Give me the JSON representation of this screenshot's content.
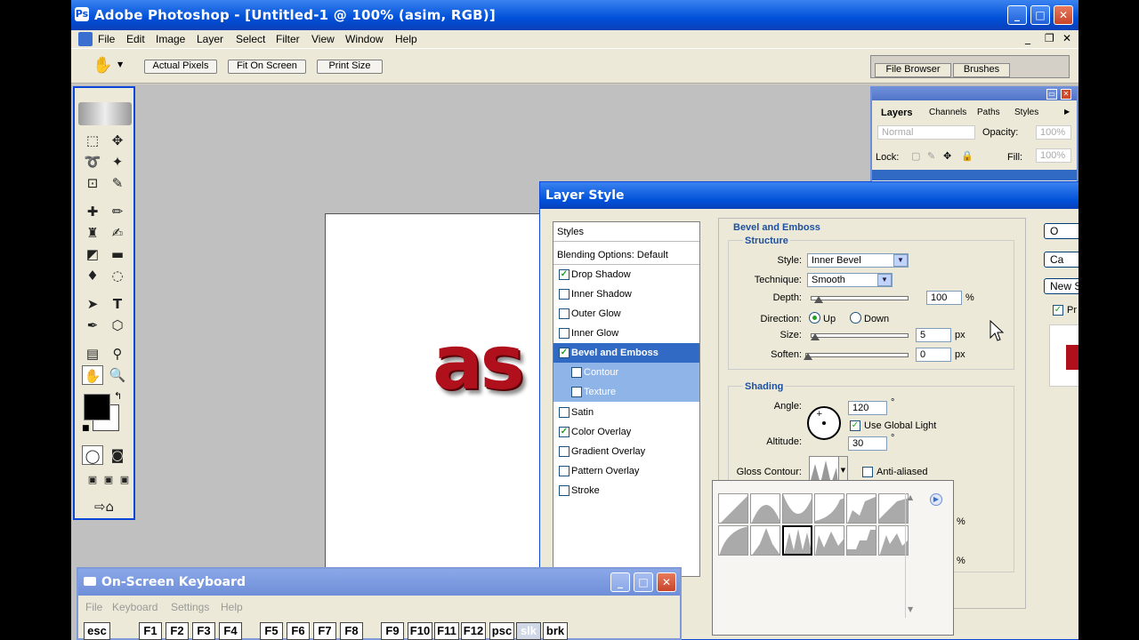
{
  "window": {
    "title": "Adobe Photoshop - [Untitled-1 @ 100% (asim, RGB)]",
    "min": "_",
    "max": "□",
    "close": "✕"
  },
  "menu": [
    "File",
    "Edit",
    "Image",
    "Layer",
    "Select",
    "Filter",
    "View",
    "Window",
    "Help"
  ],
  "options": {
    "actual_pixels": "Actual Pixels",
    "fit_on_screen": "Fit On Screen",
    "print_size": "Print Size",
    "file_browser": "File Browser",
    "brushes": "Brushes"
  },
  "document": {
    "text": "as"
  },
  "layers_palette": {
    "tabs": [
      "Layers",
      "Channels",
      "Paths",
      "Styles"
    ],
    "blend_mode": "Normal",
    "opacity_label": "Opacity:",
    "opacity_value": "100%",
    "lock_label": "Lock:",
    "fill_label": "Fill:",
    "fill_value": "100%"
  },
  "layer_style": {
    "title": "Layer Style",
    "list": [
      {
        "label": "Styles",
        "checkbox": false
      },
      {
        "label": "Blending Options: Default",
        "checkbox": false
      },
      {
        "label": "Drop Shadow",
        "checked": true
      },
      {
        "label": "Inner Shadow",
        "checked": false
      },
      {
        "label": "Outer Glow",
        "checked": false
      },
      {
        "label": "Inner Glow",
        "checked": false
      },
      {
        "label": "Bevel and Emboss",
        "checked": true
      },
      {
        "label": "Contour",
        "checked": false
      },
      {
        "label": "Texture",
        "checked": false
      },
      {
        "label": "Satin",
        "checked": false
      },
      {
        "label": "Color Overlay",
        "checked": true
      },
      {
        "label": "Gradient Overlay",
        "checked": false
      },
      {
        "label": "Pattern Overlay",
        "checked": false
      },
      {
        "label": "Stroke",
        "checked": false
      }
    ],
    "section_title": "Bevel and Emboss",
    "structure": {
      "title": "Structure",
      "style_label": "Style:",
      "style_value": "Inner Bevel",
      "technique_label": "Technique:",
      "technique_value": "Smooth",
      "depth_label": "Depth:",
      "depth_value": "100",
      "depth_unit": "%",
      "direction_label": "Direction:",
      "up": "Up",
      "down": "Down",
      "size_label": "Size:",
      "size_value": "5",
      "size_unit": "px",
      "soften_label": "Soften:",
      "soften_value": "0",
      "soften_unit": "px"
    },
    "shading": {
      "title": "Shading",
      "angle_label": "Angle:",
      "angle_value": "120",
      "deg": "°",
      "global_light": "Use Global Light",
      "altitude_label": "Altitude:",
      "altitude_value": "30",
      "gloss_label": "Gloss Contour:",
      "anti_aliased": "Anti-aliased"
    },
    "buttons": {
      "ok": "O",
      "cancel": "Ca",
      "new_style": "New S",
      "preview": "Pr"
    },
    "popup_fragments": [
      "%",
      "%"
    ]
  },
  "osk": {
    "title": "On-Screen Keyboard",
    "menu": [
      "File",
      "Keyboard",
      "Settings",
      "Help"
    ],
    "keys": [
      "esc",
      "F1",
      "F2",
      "F3",
      "F4",
      "F5",
      "F6",
      "F7",
      "F8",
      "F9",
      "F10",
      "F11",
      "F12",
      "psc",
      "slk",
      "brk"
    ]
  },
  "colors": {
    "xp_blue": "#0050d8",
    "selection": "#316ac5",
    "selection_light": "#8fb4e8",
    "text_red": "#b0101c"
  }
}
